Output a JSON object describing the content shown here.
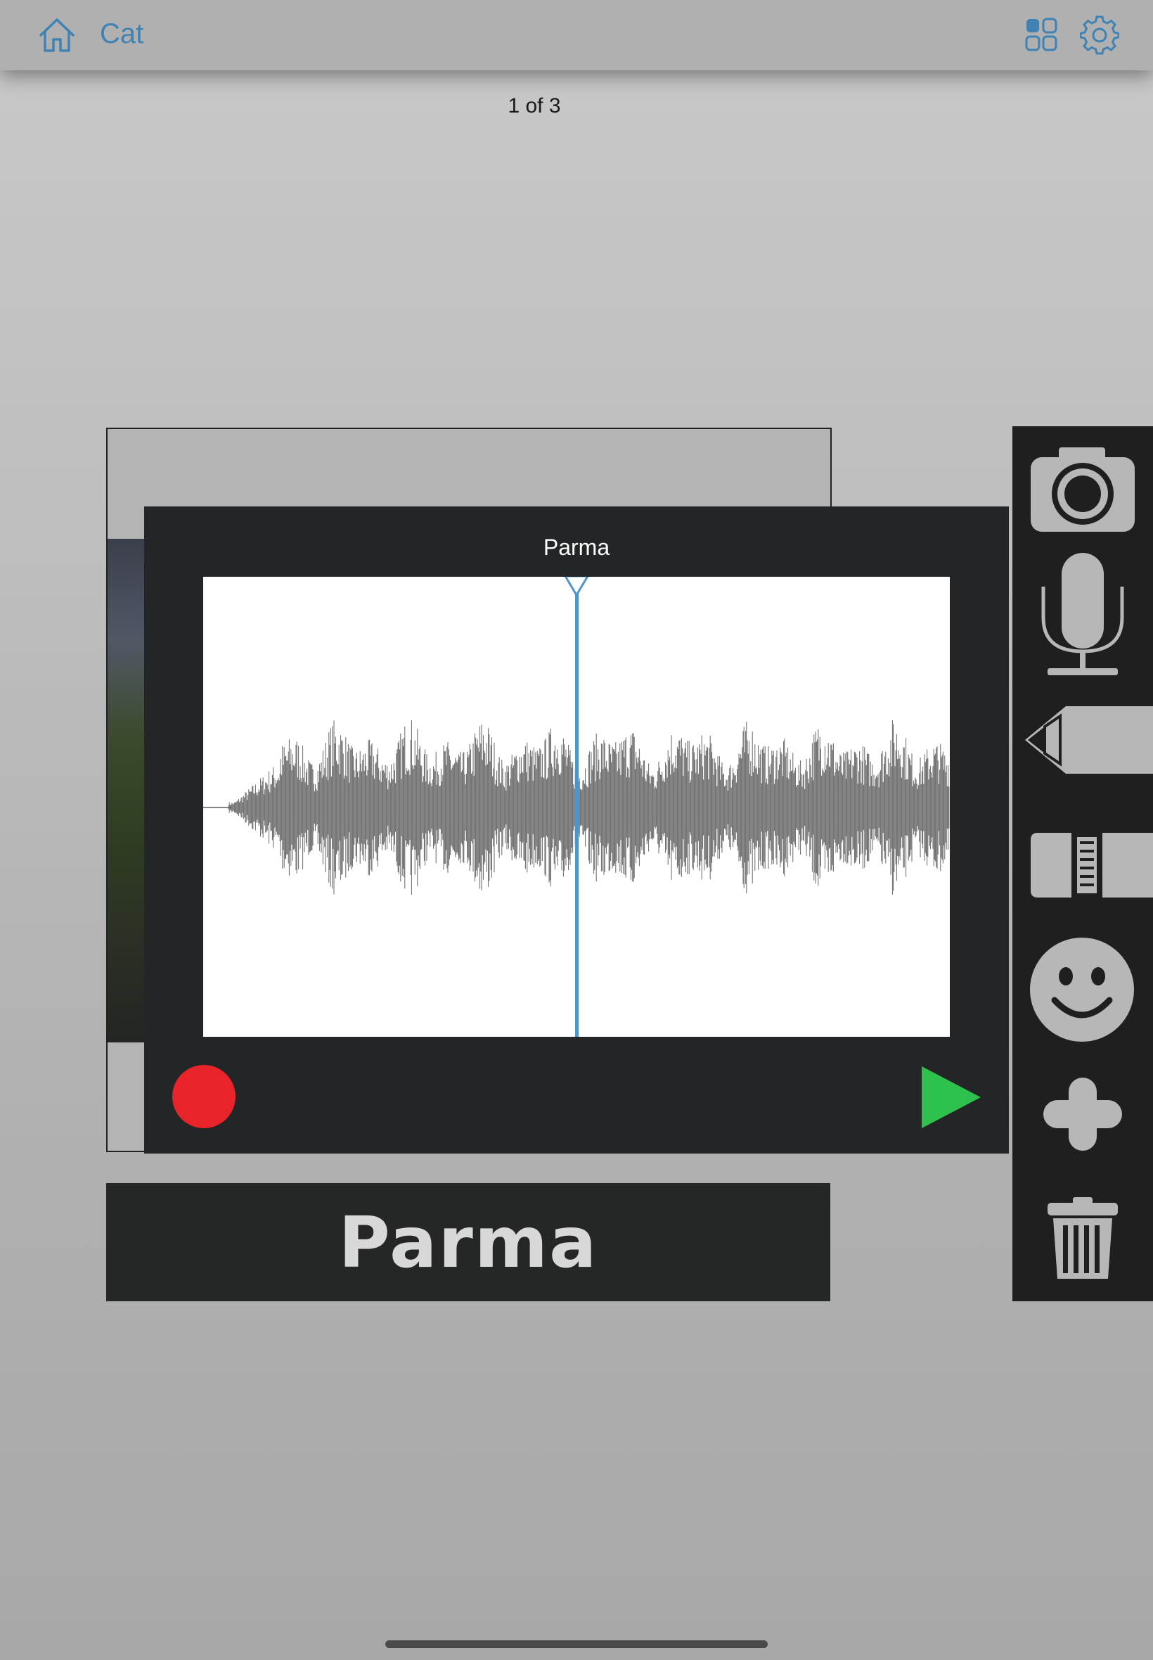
{
  "header": {
    "title": "Cat",
    "icons": [
      "home-icon",
      "grid-icon",
      "gear-icon"
    ]
  },
  "page_indicator": "1 of 3",
  "recorder": {
    "name": "Parma",
    "record_label": "",
    "play_label": ""
  },
  "card": {
    "caption": "Parma"
  },
  "toolbar": {
    "tools": [
      "camera-icon",
      "microphone-icon",
      "pencil-icon",
      "eraser-icon",
      "emoji-icon",
      "plus-icon",
      "trash-icon"
    ]
  },
  "colors": {
    "accent": "#3f82b3",
    "record": "#e8232a",
    "play": "#2fc14e",
    "playhead": "#4f95cc",
    "panel": "#232526"
  }
}
